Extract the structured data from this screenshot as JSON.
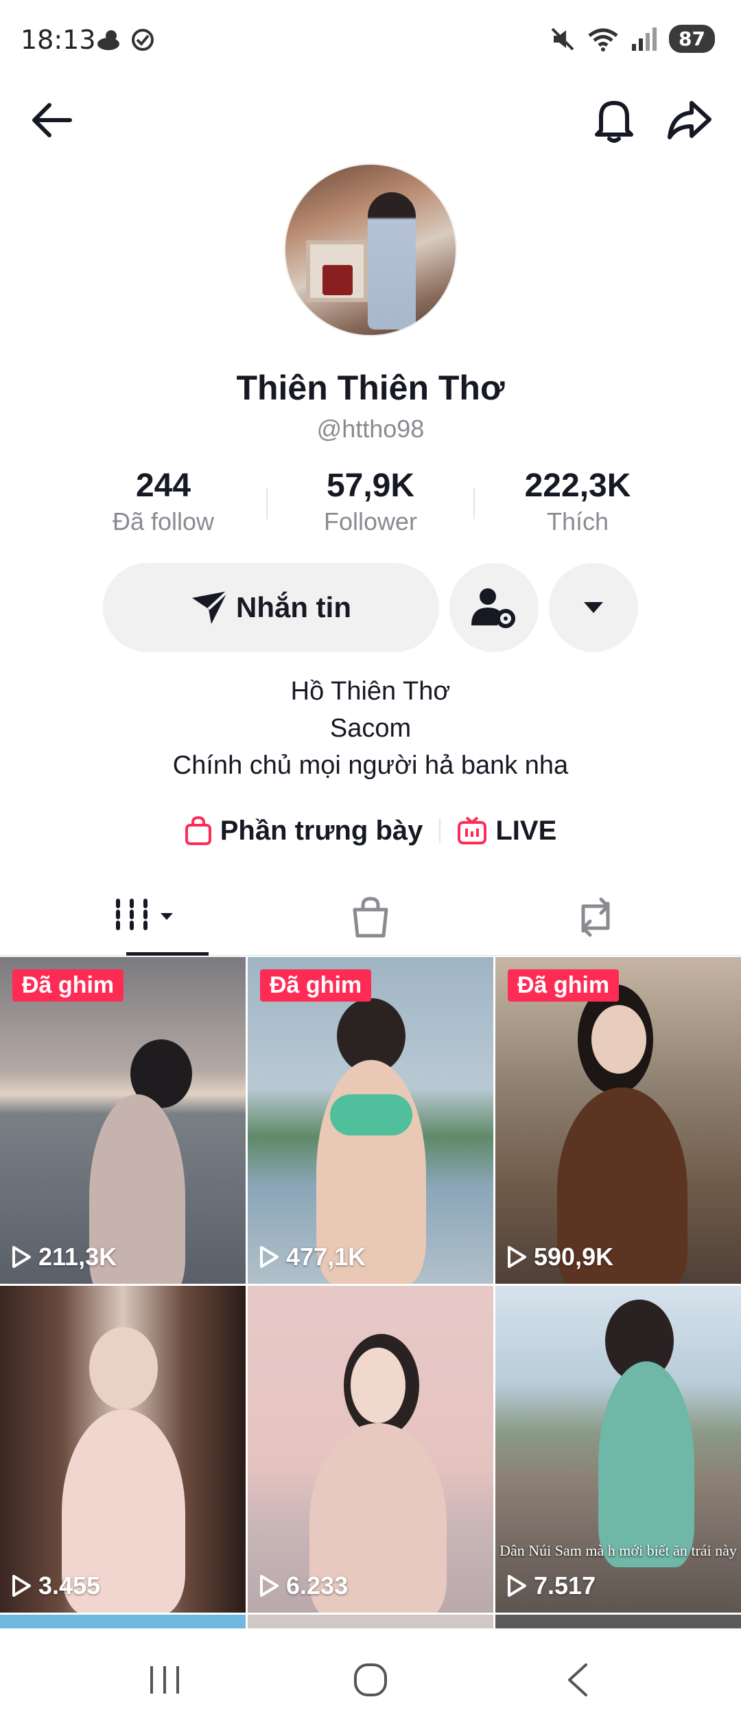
{
  "status_bar": {
    "time": "18:13",
    "battery": "87"
  },
  "profile": {
    "display_name": "Thiên Thiên Thơ",
    "username": "@httho98"
  },
  "stats": [
    {
      "value": "244",
      "label": "Đã follow"
    },
    {
      "value": "57,9K",
      "label": "Follower"
    },
    {
      "value": "222,3K",
      "label": "Thích"
    }
  ],
  "actions": {
    "message_label": "Nhắn tin"
  },
  "bio": {
    "line1": "Hồ Thiên Thơ",
    "line2": "Sacom",
    "line3": "Chính chủ mọi người hả bank nha"
  },
  "links": {
    "showcase": "Phần trưng bày",
    "live": "LIVE"
  },
  "colors": {
    "accent": "#fe2c55",
    "text": "#161823",
    "muted": "#8a8b91"
  },
  "videos": [
    {
      "pinned": "Đã ghim",
      "views": "211,3K"
    },
    {
      "pinned": "Đã ghim",
      "views": "477,1K"
    },
    {
      "pinned": "Đã ghim",
      "views": "590,9K"
    },
    {
      "pinned": "",
      "views": "3.455"
    },
    {
      "pinned": "",
      "views": "6.233"
    },
    {
      "pinned": "",
      "views": "7.517",
      "caption": "Dân Núi Sam mà h mới biết ăn trái này"
    }
  ]
}
